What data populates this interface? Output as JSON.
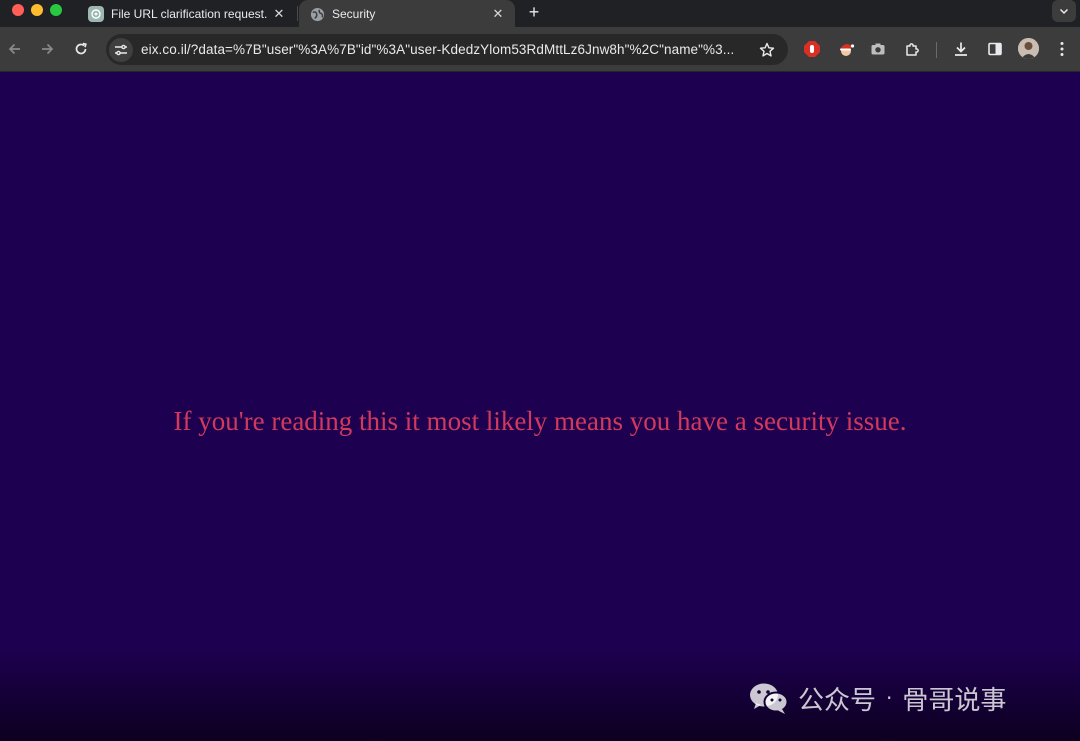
{
  "browser": {
    "tabs": [
      {
        "title": "File URL clarification request.",
        "icon": "chatgpt-icon",
        "active": false
      },
      {
        "title": "Security",
        "icon": "globe-icon",
        "active": true
      }
    ],
    "new_tab_label": "+",
    "url": "eix.co.il/?data=%7B\"user\"%3A%7B\"id\"%3A\"user-KdedzYlom53RdMttLz6Jnw8h\"%2C\"name\"%3..."
  },
  "page": {
    "message": "If you're reading this it most likely means you have a security issue."
  },
  "watermark": {
    "label": "公众号",
    "separator": "·",
    "author": "骨哥说事"
  },
  "colors": {
    "page_background": "#1e0050",
    "message_text": "#d23a5c",
    "tab_strip": "#202124",
    "toolbar": "#3c3c3c"
  }
}
